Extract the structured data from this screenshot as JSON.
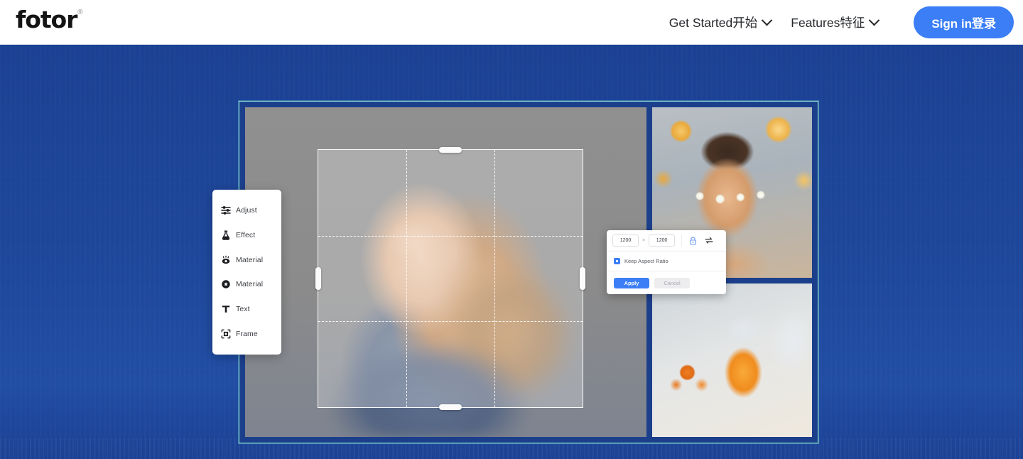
{
  "header": {
    "logo": {
      "text": "fotor",
      "trademark": "®"
    },
    "nav": [
      {
        "label": "Get Started开始",
        "icon": "chevron-down-icon",
        "name": "nav-get-started"
      },
      {
        "label": "Features特征",
        "icon": "chevron-down-icon",
        "name": "nav-features"
      }
    ],
    "signin_label": "Sign in登录",
    "signin_color": "#3b7ef5"
  },
  "hero": {
    "background_color": "#1d4699",
    "editor_border_color": "#8fe6d8",
    "editor_frame_color": "#1c3f8c"
  },
  "tool_menu": {
    "items": [
      {
        "label": "Adjust",
        "icon": "sliders-icon"
      },
      {
        "label": "Effect",
        "icon": "flask-icon"
      },
      {
        "label": "Material",
        "icon": "eye-sparkle-icon"
      },
      {
        "label": "Material",
        "icon": "sticker-badge-icon"
      },
      {
        "label": "Text",
        "icon": "text-t-icon"
      },
      {
        "label": "Frame",
        "icon": "frame-icon"
      }
    ]
  },
  "resize_dialog": {
    "width_value": "1200",
    "height_value": "1200",
    "separator": "×",
    "lock_icon": "lock-icon",
    "swap_icon": "swap-arrows-icon",
    "keep_aspect_ratio_label": "Keep Aspect Ratio",
    "keep_aspect_ratio_checked": true,
    "apply_label": "Apply",
    "cancel_label": "Cancel",
    "apply_color": "#3b7ef5",
    "cancel_color": "#ededef"
  },
  "canvas": {
    "background_color": "#8e8e8e",
    "crop_overlay": "rule-of-thirds"
  }
}
